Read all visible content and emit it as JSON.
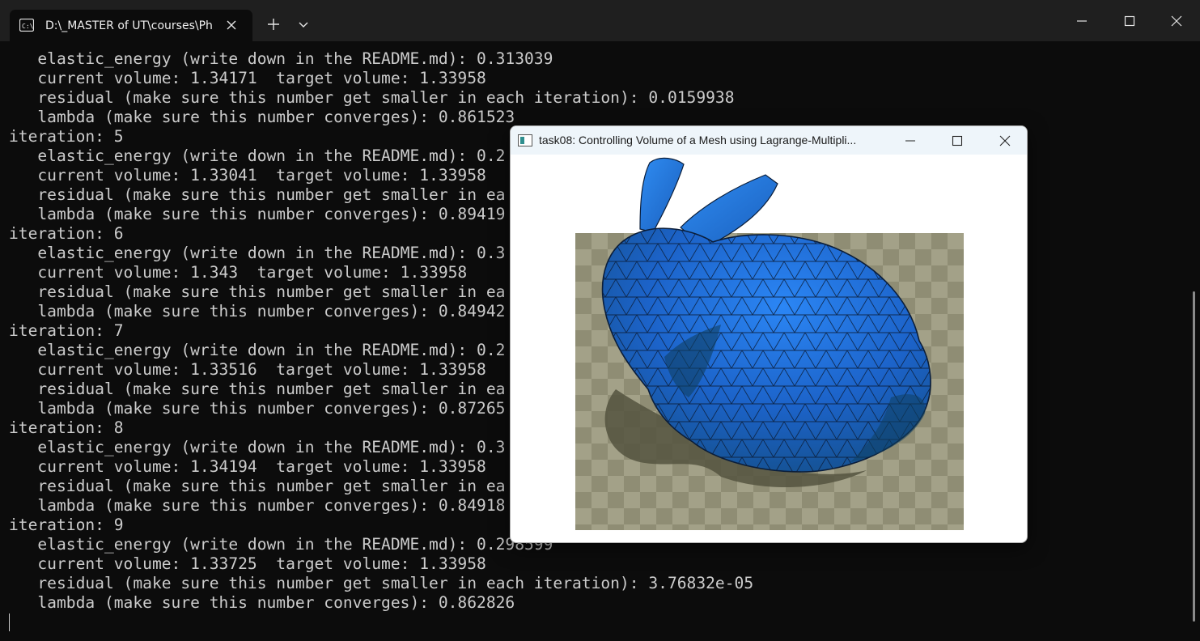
{
  "terminal": {
    "tab_title": "D:\\_MASTER of UT\\courses\\Ph",
    "tab_icon": "command-prompt-icon",
    "lines": [
      "   elastic_energy (write down in the README.md): 0.313039",
      "   current volume: 1.34171  target volume: 1.33958",
      "   residual (make sure this number get smaller in each iteration): 0.0159938",
      "   lambda (make sure this number converges): 0.861523",
      "iteration: 5",
      "   elastic_energy (write down in the README.md): 0.2",
      "   current volume: 1.33041  target volume: 1.33958",
      "   residual (make sure this number get smaller in ea",
      "   lambda (make sure this number converges): 0.89419",
      "iteration: 6",
      "   elastic_energy (write down in the README.md): 0.3",
      "   current volume: 1.343  target volume: 1.33958",
      "   residual (make sure this number get smaller in ea",
      "   lambda (make sure this number converges): 0.84942",
      "iteration: 7",
      "   elastic_energy (write down in the README.md): 0.2",
      "   current volume: 1.33516  target volume: 1.33958",
      "   residual (make sure this number get smaller in ea",
      "   lambda (make sure this number converges): 0.87265",
      "iteration: 8",
      "   elastic_energy (write down in the README.md): 0.3",
      "   current volume: 1.34194  target volume: 1.33958",
      "   residual (make sure this number get smaller in ea",
      "   lambda (make sure this number converges): 0.84918",
      "iteration: 9",
      "   elastic_energy (write down in the README.md): 0.298599",
      "   current volume: 1.33725  target volume: 1.33958",
      "   residual (make sure this number get smaller in each iteration): 3.76832e-05",
      "   lambda (make sure this number converges): 0.862826"
    ]
  },
  "viewer": {
    "title": "task08: Controlling Volume of a Mesh using Lagrange-Multipli...",
    "mesh_color": "#1f6fd8",
    "floor_colors": [
      "#8f8d74",
      "#a3a188"
    ]
  },
  "colors": {
    "terminal_bg": "#0c0c0c",
    "terminal_text": "#cccccc",
    "titlebar_bg": "#1f1f1f"
  }
}
